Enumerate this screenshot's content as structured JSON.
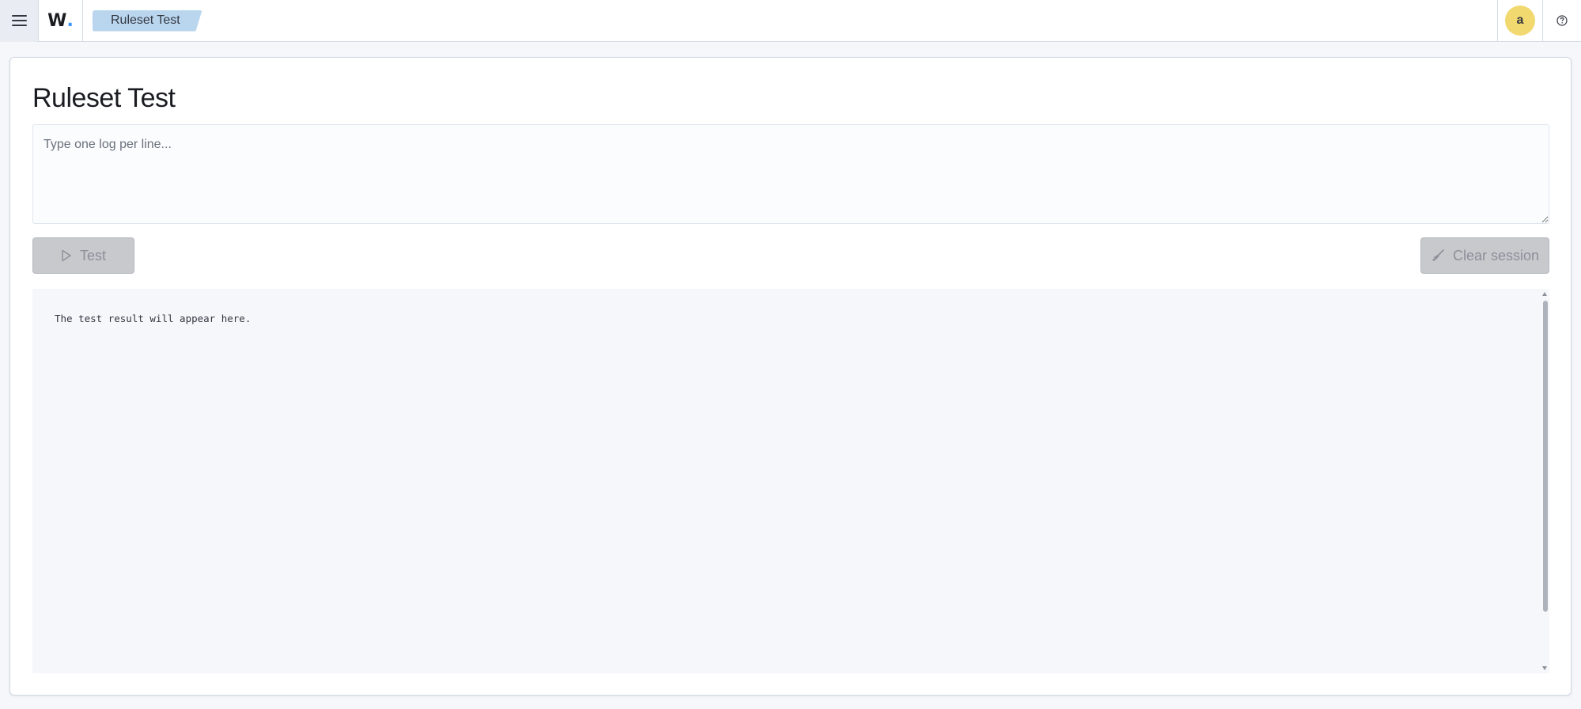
{
  "header": {
    "menu_icon": "hamburger-menu-icon",
    "logo": {
      "letter": "W",
      "dot": ".",
      "dot_color": "#3595f9"
    },
    "breadcrumb": "Ruleset Test",
    "user_initial": "a",
    "avatar_color": "#f1d86f",
    "help_icon": "question-circle-icon"
  },
  "main": {
    "title": "Ruleset Test",
    "input_placeholder": "Type one log per line...",
    "input_value": "",
    "test_button": {
      "label": "Test",
      "icon": "play-icon",
      "disabled": true
    },
    "clear_button": {
      "label": "Clear session",
      "icon": "broom-icon",
      "disabled": true
    },
    "result_text": "The test result will appear here."
  }
}
